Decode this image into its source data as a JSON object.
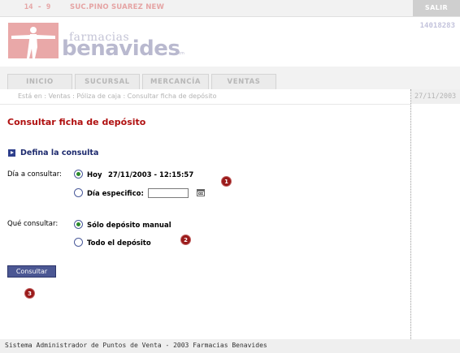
{
  "topbar": {
    "branch_id": "14 - 9",
    "branch_name": "SUC.PINO SUAREZ NEW",
    "logout_label": "SALIR"
  },
  "header": {
    "logo_line1": "farmacias",
    "logo_line2": "benavides",
    "logo_tm": "tm",
    "user_id": "14018283"
  },
  "nav": {
    "tabs": [
      {
        "label": "INICIO"
      },
      {
        "label": "SUCURSAL"
      },
      {
        "label": "MERCANCÍA"
      },
      {
        "label": "VENTAS"
      }
    ]
  },
  "breadcrumb": {
    "text": "Está en : Ventas : Póliza de caja : Consultar ficha de depósito",
    "date": "27/11/2003"
  },
  "page": {
    "title": "Consultar ficha de depósito",
    "section_title": "Defina la consulta",
    "day_label": "Día a consultar:",
    "today_label": "Hoy",
    "today_value": "27/11/2003 - 12:15:57",
    "specific_day_label": "Día especifico:",
    "specific_day_value": "",
    "what_label": "Qué consultar:",
    "opt_manual": "Sólo depósito manual",
    "opt_all": "Todo el depósito",
    "submit_label": "Consultar",
    "markers": [
      "1",
      "2",
      "3"
    ]
  },
  "footer": {
    "text": "Sistema Administrador de Puntos de Venta - 2003 Farmacias Benavides"
  },
  "colors": {
    "title": "#b01010",
    "section": "#1d2a6e",
    "button": "#4b5793",
    "marker": "#9a1a1a"
  }
}
